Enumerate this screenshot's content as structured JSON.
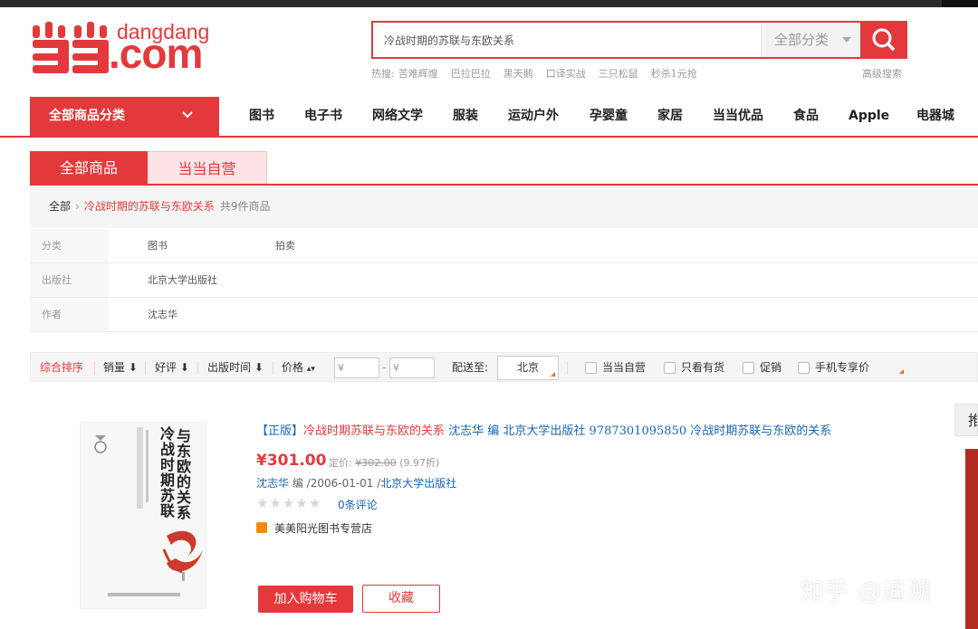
{
  "logo": {
    "word_top": "dangdang",
    "word_main": ".com"
  },
  "search": {
    "value": "冷战时期的苏联与东欧关系",
    "category": "全部分类"
  },
  "hot": {
    "label": "热搜:",
    "terms": [
      "苦难辉煌",
      "巴拉巴拉",
      "黑天鹅",
      "口译实战",
      "三只松鼠",
      "秒杀1元抢"
    ]
  },
  "advanced_search": "高级搜索",
  "nav": {
    "all_categories": "全部商品分类",
    "items": [
      "图书",
      "电子书",
      "网络文学",
      "服装",
      "运动户外",
      "孕婴童",
      "家居",
      "当当优品",
      "食品",
      "Apple",
      "电器城"
    ]
  },
  "tabs": [
    "全部商品",
    "当当自营"
  ],
  "breadcrumb": {
    "root": "全部",
    "keyword": "冷战时期的苏联与东欧关系",
    "count": "共9件商品"
  },
  "filters": [
    {
      "label": "分类",
      "values": [
        "图书",
        "拍卖"
      ]
    },
    {
      "label": "出版社",
      "values": [
        "北京大学出版社"
      ]
    },
    {
      "label": "作者",
      "values": [
        "沈志华"
      ]
    }
  ],
  "sort": {
    "items": [
      "综合排序",
      "销量",
      "好评",
      "出版时间",
      "价格"
    ],
    "price_from": "¥",
    "price_to": "¥",
    "ship_label": "配送至:",
    "city": "北京",
    "checkboxes": [
      "当当自营",
      "只看有货",
      "促销",
      "手机专享价"
    ]
  },
  "product": {
    "tag": "【正版】",
    "title_highlight": "冷战时期苏联与东欧的关系",
    "title_rest": " 沈志华  编  北京大学出版社  9787301095850  冷战时期苏联与东欧的关系",
    "price": "¥301.00",
    "orig_label": "定价:",
    "orig_price": "¥302.00",
    "discount": "(9.97折)",
    "author": "沈志华",
    "author_role": " 编 ",
    "date": "/2006-01-01 /",
    "publisher": "北京大学出版社",
    "rating": 0,
    "reviews": "0条评论",
    "shop": "美美阳光图书专营店",
    "add_to_cart": "加入购物车",
    "favorite": "收藏",
    "cover": {
      "title_lines": [
        "冷战时期苏联",
        "与东欧的关系"
      ]
    }
  },
  "right_panel": {
    "head": "推"
  },
  "watermark": "知乎 @追溯",
  "colors": {
    "accent": "#e4393c",
    "link": "#1a66b3",
    "pink_tab": "#fce4e6"
  }
}
